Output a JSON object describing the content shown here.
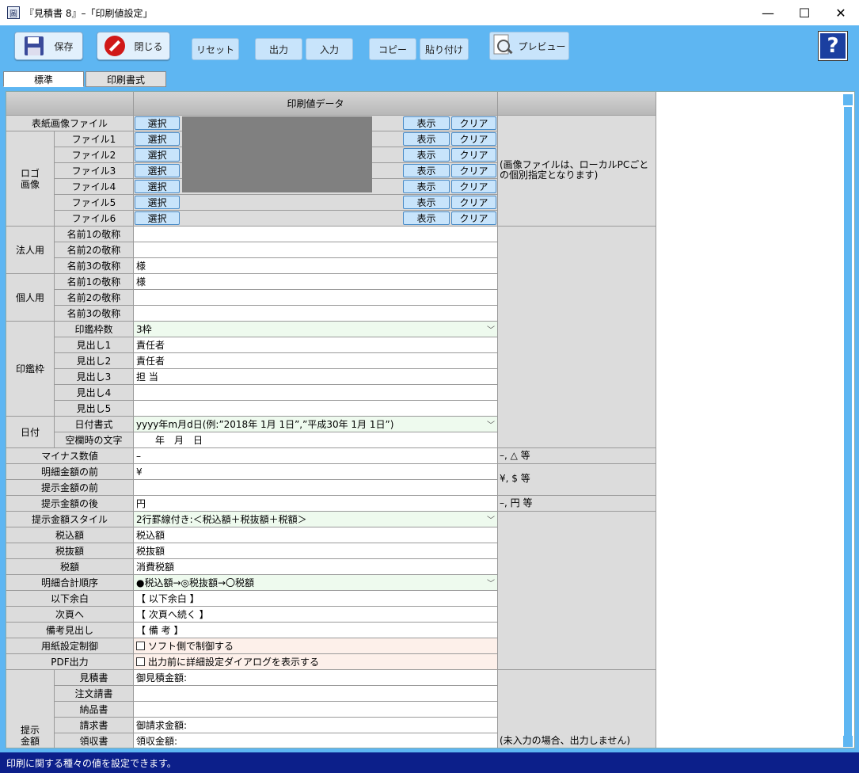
{
  "window": {
    "title": "『見積書 8』–「印刷値設定」",
    "icon": "app-icon",
    "minimize": "—",
    "maximize": "☐",
    "close": "✕"
  },
  "toolbar": {
    "save": "保存",
    "close": "閉じる",
    "reset": "リセット",
    "output": "出力",
    "input": "入力",
    "copy": "コピー",
    "paste": "貼り付け",
    "preview": "プレビュー",
    "help": "?"
  },
  "tabs": [
    "標準",
    "印刷書式"
  ],
  "header": {
    "col_data": "印刷値データ"
  },
  "buttons": {
    "select": "選択",
    "show": "表示",
    "clear": "クリア"
  },
  "groups": {
    "logo": "ロゴ\n画像",
    "corp": "法人用",
    "personal": "個人用",
    "seal": "印鑑枠",
    "date": "日付",
    "presentation": "提示\n金額"
  },
  "rows": {
    "cover_file": "表紙画像ファイル",
    "files": [
      "ファイル1",
      "ファイル2",
      "ファイル3",
      "ファイル4",
      "ファイル5",
      "ファイル6"
    ],
    "corp_honorifics": [
      {
        "label": "名前1の敬称",
        "value": ""
      },
      {
        "label": "名前2の敬称",
        "value": ""
      },
      {
        "label": "名前3の敬称",
        "value": "様"
      }
    ],
    "personal_honorifics": [
      {
        "label": "名前1の敬称",
        "value": "様"
      },
      {
        "label": "名前2の敬称",
        "value": ""
      },
      {
        "label": "名前3の敬称",
        "value": ""
      }
    ],
    "seal_count": {
      "label": "印鑑枠数",
      "value": "3枠"
    },
    "seal_headings": [
      {
        "label": "見出し1",
        "value": "責任者"
      },
      {
        "label": "見出し2",
        "value": "責任者"
      },
      {
        "label": "見出し3",
        "value": "担 当"
      },
      {
        "label": "見出し4",
        "value": ""
      },
      {
        "label": "見出し5",
        "value": ""
      }
    ],
    "date_format": {
      "label": "日付書式",
      "value": "yyyy年m月d日(例:”2018年 1月 1日”,”平成30年 1月 1日”)"
    },
    "date_blank": {
      "label": "空欄時の文字",
      "value": "　　年　月　日"
    },
    "minus": {
      "label": "マイナス数値",
      "value": "–"
    },
    "detail_before": {
      "label": "明細金額の前",
      "value": "¥"
    },
    "present_before": {
      "label": "提示金額の前",
      "value": ""
    },
    "present_after": {
      "label": "提示金額の後",
      "value": "円"
    },
    "present_style": {
      "label": "提示金額スタイル",
      "value": "2行罫線付き:＜税込額＋税抜額＋税額＞"
    },
    "tax_incl": {
      "label": "税込額",
      "value": "税込額"
    },
    "tax_excl": {
      "label": "税抜額",
      "value": "税抜額"
    },
    "tax": {
      "label": "税額",
      "value": "消費税額"
    },
    "total_order": {
      "label": "明細合計順序",
      "value": "●税込額→◎税抜額→〇税額"
    },
    "below_blank": {
      "label": "以下余白",
      "value": "【 以下余白 】"
    },
    "next_page": {
      "label": "次頁へ",
      "value": "【 次頁へ続く 】"
    },
    "remarks": {
      "label": "備考見出し",
      "value": "【 備 考 】"
    },
    "paper_ctrl": {
      "label": "用紙設定制御",
      "value": "ソフト側で制御する"
    },
    "pdf_out": {
      "label": "PDF出力",
      "value": "出力前に詳細設定ダイアログを表示する"
    },
    "present_docs": [
      {
        "label": "見積書",
        "value": "御見積金額:"
      },
      {
        "label": "注文請書",
        "value": ""
      },
      {
        "label": "納品書",
        "value": ""
      },
      {
        "label": "請求書",
        "value": "御請求金額:"
      },
      {
        "label": "領収書",
        "value": "領収金額:"
      }
    ]
  },
  "notes": {
    "image": "(画像ファイルは、ローカルPCごとの個別指定となります)",
    "minus": "–, △ 等",
    "yen": "¥, $ 等",
    "after": "–, 円 等",
    "present": "(未入力の場合、出力しません)"
  },
  "status": "印刷に関する種々の値を設定できます。"
}
